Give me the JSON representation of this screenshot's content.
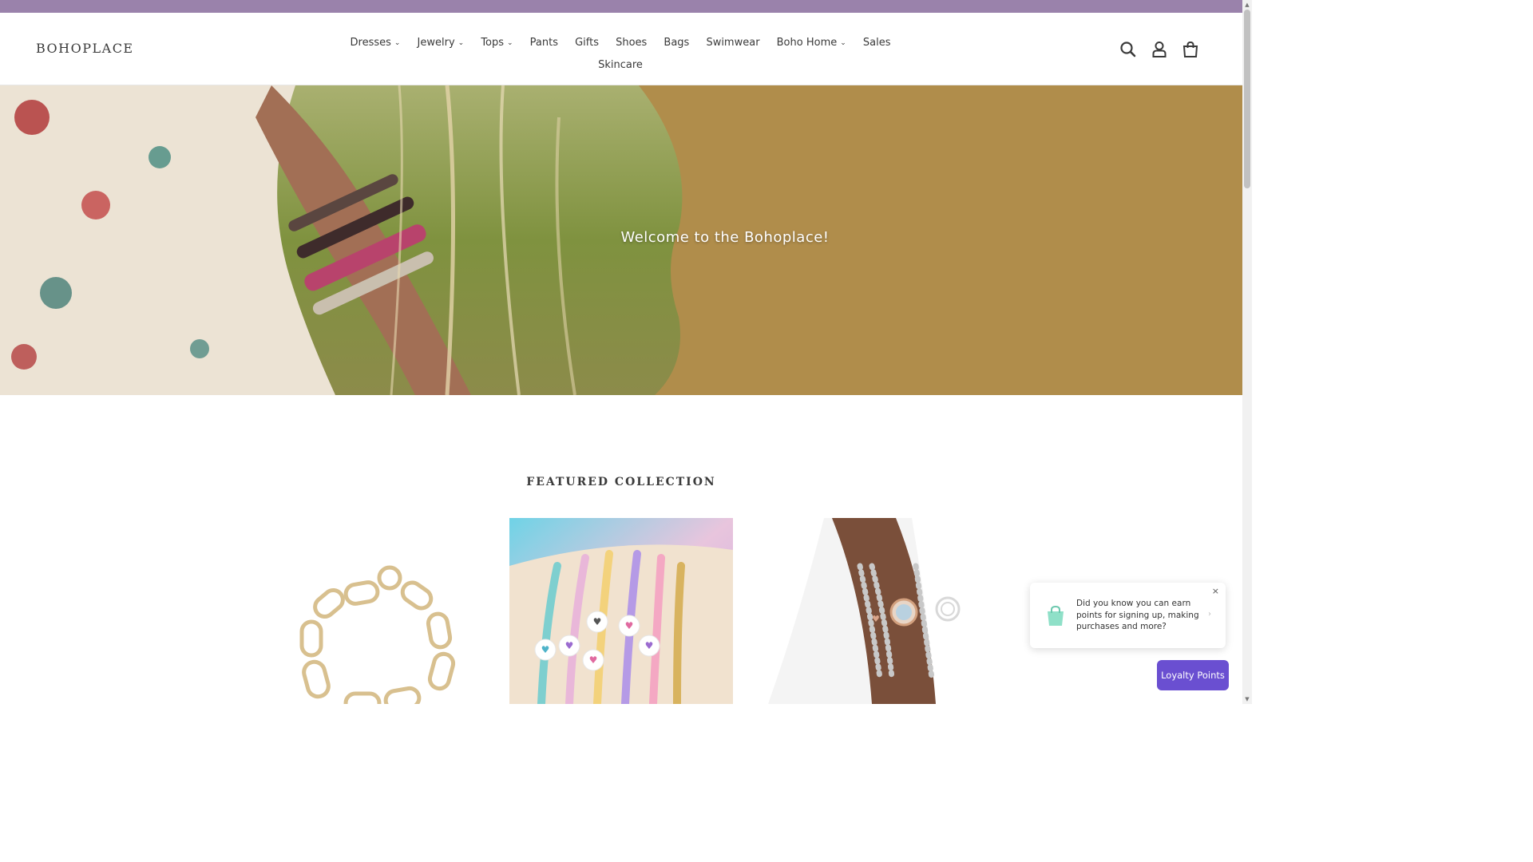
{
  "header": {
    "logo": "BOHOPLACE",
    "nav": [
      {
        "label": "Dresses",
        "has_dropdown": true
      },
      {
        "label": "Jewelry",
        "has_dropdown": true
      },
      {
        "label": "Tops",
        "has_dropdown": true
      },
      {
        "label": "Pants",
        "has_dropdown": false
      },
      {
        "label": "Gifts",
        "has_dropdown": false
      },
      {
        "label": "Shoes",
        "has_dropdown": false
      },
      {
        "label": "Bags",
        "has_dropdown": false
      },
      {
        "label": "Swimwear",
        "has_dropdown": false
      },
      {
        "label": "Boho Home",
        "has_dropdown": true
      },
      {
        "label": "Sales",
        "has_dropdown": false
      },
      {
        "label": "Skincare",
        "has_dropdown": false
      }
    ],
    "icons": [
      "search-icon",
      "account-icon",
      "cart-icon"
    ]
  },
  "hero": {
    "title": "Welcome to the Bohoplace!"
  },
  "featured": {
    "title": "FEATURED COLLECTION",
    "products": [
      {
        "image": "gold-chain-bracelet"
      },
      {
        "image": "heart-bead-bracelets"
      },
      {
        "image": "stone-watch-bracelet-set"
      }
    ]
  },
  "loyalty": {
    "popup_text": "Did you know you can earn points for signing up, making purchases and more?",
    "close_label": "×",
    "button_label": "Loyalty Points"
  },
  "colors": {
    "announcement": "#9a82ab",
    "hero_bg": "#b08d4b",
    "loyalty_button": "#6a4fd1"
  }
}
